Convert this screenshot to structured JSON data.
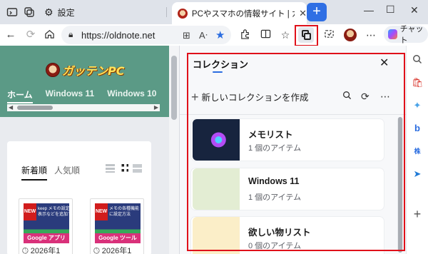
{
  "tabs": {
    "settings_label": "設定",
    "active_title": "PCやスマホの情報サイト | ガッテンPC"
  },
  "address": {
    "url": "https://oldnote.net"
  },
  "toolbar": {
    "chat_label": "チャット"
  },
  "site": {
    "logo_text": "ガッテンPC",
    "nav": [
      "ホーム",
      "Windows 11",
      "Windows 10"
    ],
    "sort_tabs": [
      "新着順",
      "人気順"
    ],
    "articles": [
      {
        "new_badge": "NEW",
        "caption": "keep メモの設定",
        "caption2": "表示などを追加する",
        "band": "Google アプリ",
        "date": "2026年1"
      },
      {
        "new_badge": "NEW",
        "caption": "メモの各種機能",
        "caption2": "に設定方法",
        "band": "Google ツール",
        "date": "2026年1"
      }
    ]
  },
  "panel": {
    "title": "コレクション",
    "new_collection_label": "新しいコレクションを作成",
    "collections": [
      {
        "name": "メモリスト",
        "count": "1 個のアイテム",
        "thumb_color": "#1c2740"
      },
      {
        "name": "Windows 11",
        "count": "1 個のアイテム",
        "thumb_color": "#e3edd3"
      },
      {
        "name": "欲しい物リスト",
        "count": "0 個のアイテム",
        "thumb_color": "#fbeec8"
      }
    ]
  },
  "colors": {
    "accent": "#2b6de0",
    "highlight": "#e0101a",
    "site_header": "#5b9a86"
  }
}
